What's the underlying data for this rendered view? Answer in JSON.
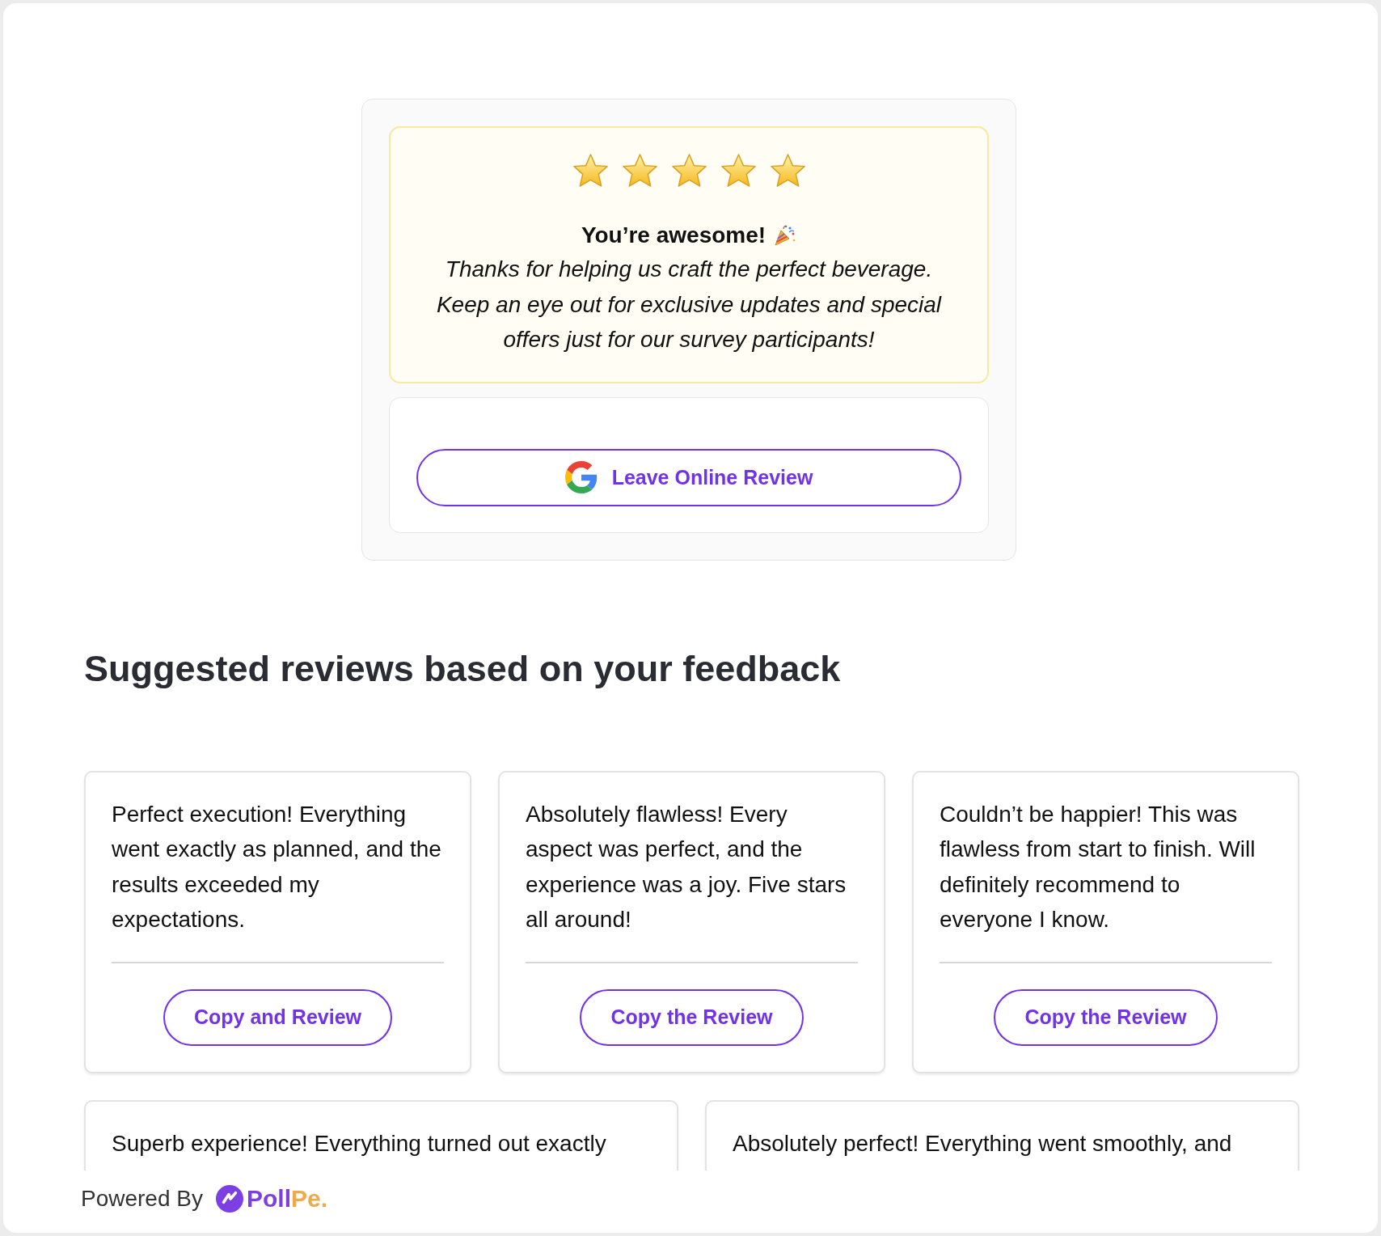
{
  "rating": {
    "stars": 5,
    "title": "You’re awesome!",
    "message": "Thanks for helping us craft the perfect beverage. Keep an eye out for exclusive updates and special offers just for our survey participants!"
  },
  "review_button": {
    "label": "Leave Online Review"
  },
  "suggestions": {
    "heading": "Suggested reviews based on your feedback",
    "cards": [
      {
        "text": "Perfect execution! Everything went exactly as planned, and the results exceeded my expectations.",
        "button": "Copy and Review"
      },
      {
        "text": "Absolutely flawless! Every aspect was perfect, and the experience was a joy. Five stars all around!",
        "button": "Copy the Review"
      },
      {
        "text": "Couldn’t be happier! This was flawless from start to finish. Will definitely recommend to everyone I know.",
        "button": "Copy the Review"
      },
      {
        "text": "Superb experience! Everything turned out exactly"
      },
      {
        "text": "Absolutely perfect! Everything went smoothly, and"
      }
    ]
  },
  "footer": {
    "label": "Powered By",
    "brand_parts": [
      "Poll",
      "Pe."
    ]
  }
}
